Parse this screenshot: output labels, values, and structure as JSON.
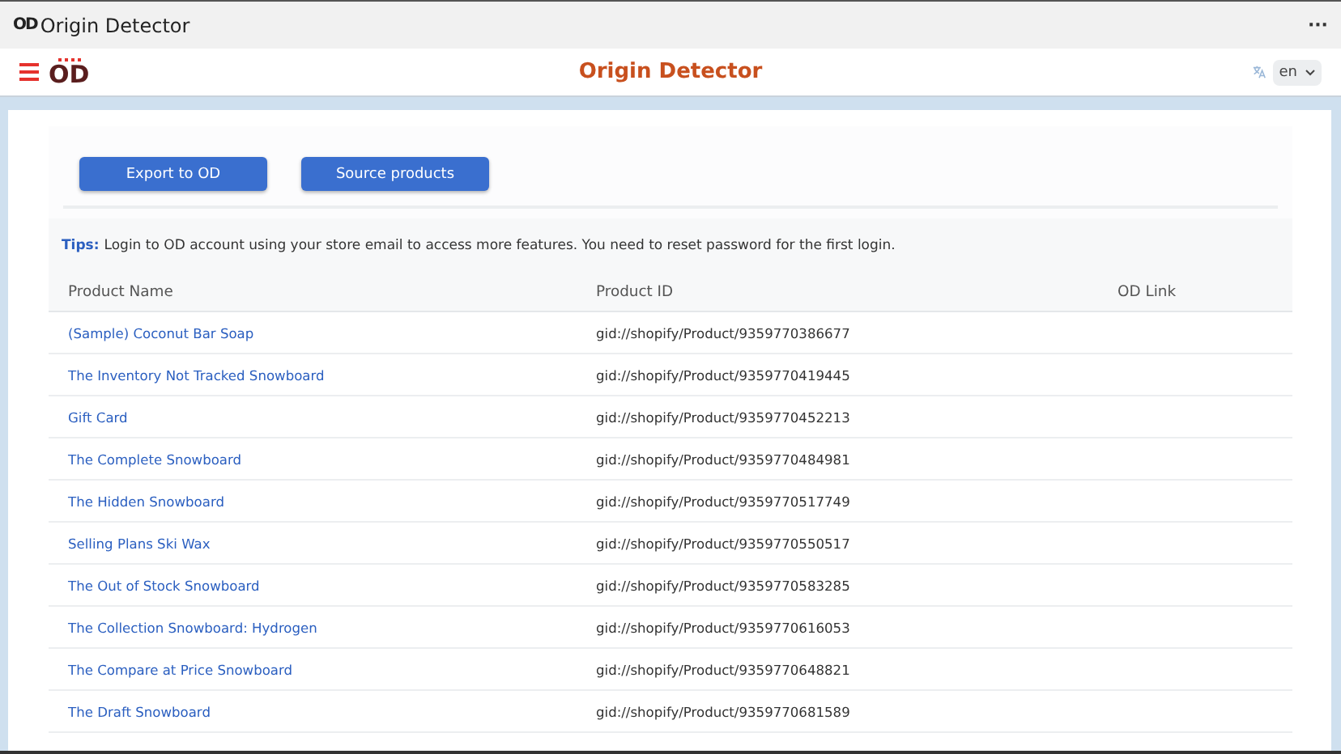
{
  "window": {
    "logo": "OD",
    "title": "Origin Detector",
    "more": "···"
  },
  "header": {
    "logo": "OD",
    "title": "Origin Detector",
    "language": "en"
  },
  "buttons": [
    "Export to OD",
    "Source products"
  ],
  "tips": {
    "label": "Tips:",
    "text": "Login to OD account using your store email to access more features. You need to reset password for the first login."
  },
  "table": {
    "columns": [
      "Product Name",
      "Product ID",
      "OD Link"
    ],
    "rows": [
      {
        "name": "(Sample) Coconut Bar Soap",
        "id": "gid://shopify/Product/9359770386677"
      },
      {
        "name": "The Inventory Not Tracked Snowboard",
        "id": "gid://shopify/Product/9359770419445"
      },
      {
        "name": "Gift Card",
        "id": "gid://shopify/Product/9359770452213"
      },
      {
        "name": "The Complete Snowboard",
        "id": "gid://shopify/Product/9359770484981"
      },
      {
        "name": "The Hidden Snowboard",
        "id": "gid://shopify/Product/9359770517749"
      },
      {
        "name": "Selling Plans Ski Wax",
        "id": "gid://shopify/Product/9359770550517"
      },
      {
        "name": "The Out of Stock Snowboard",
        "id": "gid://shopify/Product/9359770583285"
      },
      {
        "name": "The Collection Snowboard: Hydrogen",
        "id": "gid://shopify/Product/9359770616053"
      },
      {
        "name": "The Compare at Price Snowboard",
        "id": "gid://shopify/Product/9359770648821"
      },
      {
        "name": "The Draft Snowboard",
        "id": "gid://shopify/Product/9359770681589"
      }
    ]
  }
}
